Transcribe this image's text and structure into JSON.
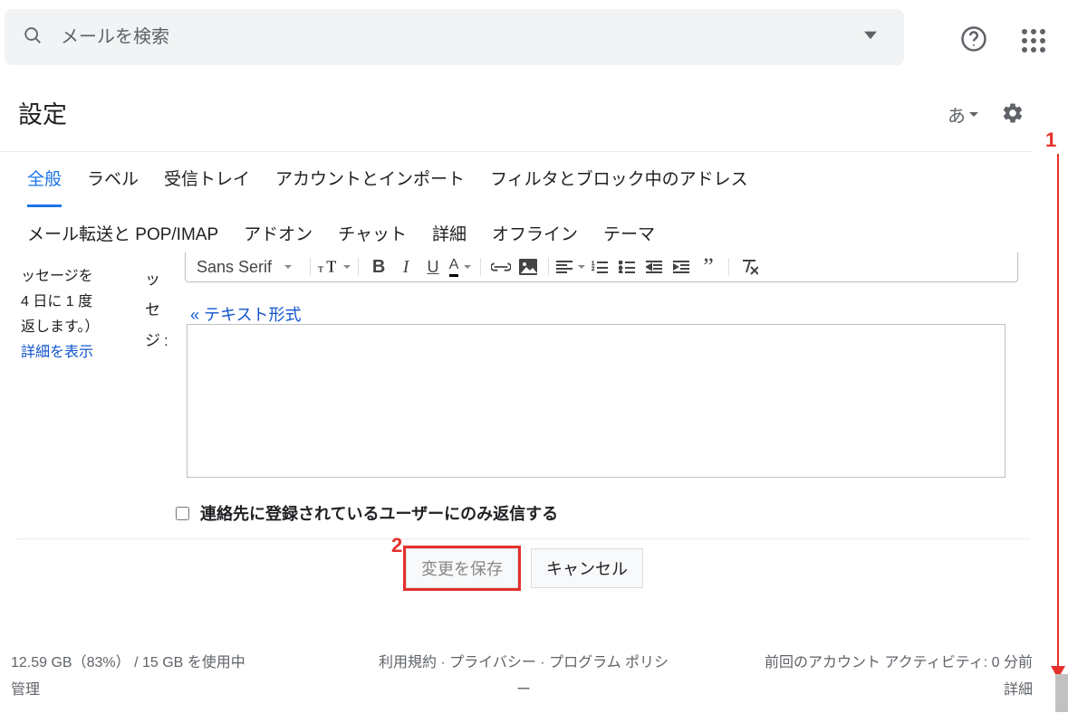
{
  "search": {
    "placeholder": "メールを検索"
  },
  "pageTitle": "設定",
  "langBtn": "あ",
  "tabs": {
    "row1": [
      "全般",
      "ラベル",
      "受信トレイ",
      "アカウントとインポート",
      "フィルタとブロック中のアドレス"
    ],
    "row2": [
      "メール転送と POP/IMAP",
      "アドオン",
      "チャット",
      "詳細",
      "オフライン",
      "テーマ"
    ],
    "activeIndex": 0
  },
  "leftText": {
    "l1": "ッセージを",
    "l2": "4 日に 1 度",
    "l3": "返します。）",
    "link": "詳細を表示"
  },
  "midText": {
    "c1": "ッ",
    "c2": "セ",
    "c3": "ジ:"
  },
  "toolbar": {
    "fontName": "Sans Serif"
  },
  "plainTextLink": "« テキスト形式",
  "contactsOnlyLabel": "連絡先に登録されているユーザーにのみ返信する",
  "buttons": {
    "save": "変更を保存",
    "cancel": "キャンセル"
  },
  "markers": {
    "one": "1",
    "two": "2"
  },
  "footer": {
    "storage": "12.59 GB（83%） / 15 GB を使用中",
    "manage": "管理",
    "links": "利用規約 · プライバシー · プログラム ポリシ",
    "linksCont": "ー",
    "activity": "前回のアカウント アクティビティ: 0 分前",
    "details": "詳細"
  }
}
